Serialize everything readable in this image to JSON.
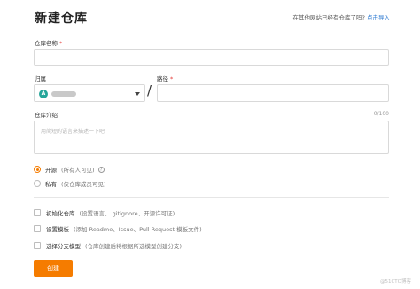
{
  "page": {
    "title": "新建仓库",
    "import_hint": "在其他网站已经有仓库了吗?",
    "import_link": "点击导入"
  },
  "form": {
    "repo_name": {
      "label": "仓库名称",
      "required": "*",
      "value": ""
    },
    "owner": {
      "label": "归属",
      "avatar_letter": "A"
    },
    "path": {
      "label": "路径",
      "required": "*",
      "separator": "/",
      "value": ""
    },
    "description": {
      "label": "仓库介绍",
      "counter": "0/100",
      "placeholder": "用简短的语言来描述一下吧"
    },
    "visibility": [
      {
        "label": "开源",
        "note": "(所有人可见)",
        "selected": true
      },
      {
        "label": "私有",
        "note": "(仅仓库成员可见)",
        "selected": false
      }
    ],
    "options": [
      {
        "label": "初始化仓库",
        "note": "(设置语言、.gitignore、开源许可证)",
        "checked": false
      },
      {
        "label": "设置模板",
        "note": "(添加 Readme、Issue、Pull Request 模板文件)",
        "checked": false
      },
      {
        "label": "选择分支模型",
        "note": "(仓库创建后将根据所选模型创建分支)",
        "checked": false
      }
    ],
    "submit_label": "创建"
  },
  "watermark": "@51CTO博客",
  "colors": {
    "accent": "#f57c00",
    "link": "#2e7ad1",
    "required": "#e53935",
    "avatar": "#26a69a"
  }
}
